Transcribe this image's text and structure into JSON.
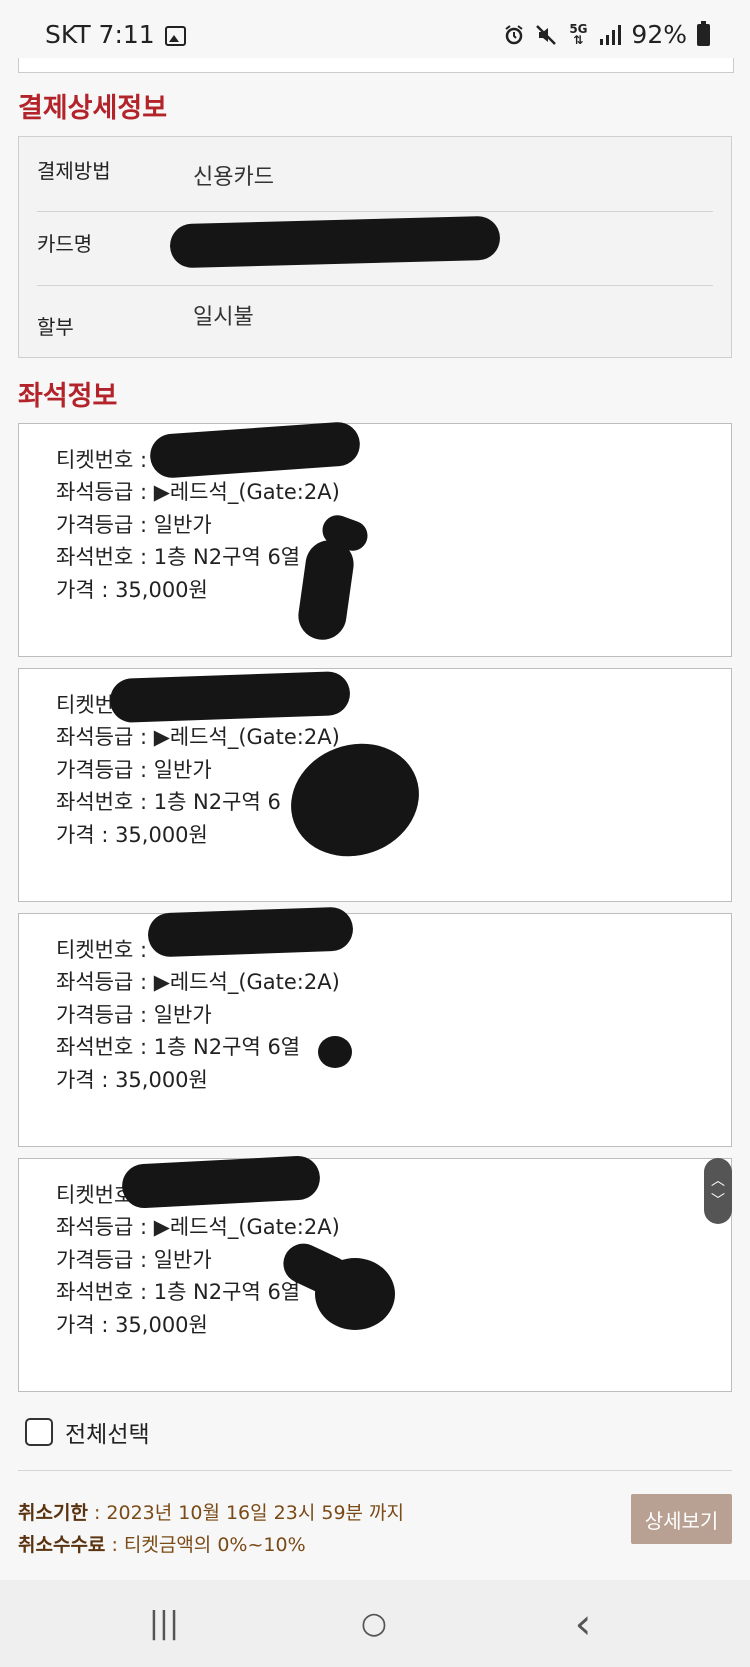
{
  "status_bar": {
    "carrier_time": "SKT 7:11",
    "network": "5G",
    "battery": "92%"
  },
  "payment_section": {
    "title": "결제상세정보",
    "rows": [
      {
        "label": "결제방법",
        "value": "신용카드"
      },
      {
        "label": "카드명",
        "value": ""
      },
      {
        "label": "할부",
        "value": "일시불"
      }
    ]
  },
  "seat_section": {
    "title": "좌석정보",
    "tickets": [
      {
        "ticket_no": "티켓번호 :",
        "grade": "좌석등급 : ▶레드석_(Gate:2A)",
        "price_grade": "가격등급 : 일반가",
        "seat_no": "좌석번호 : 1층 N2구역 6열",
        "price": "가격 : 35,000원"
      },
      {
        "ticket_no": "티켓번",
        "grade": "좌석등급 : ▶레드석_(Gate:2A)",
        "price_grade": "가격등급 : 일반가",
        "seat_no": "좌석번호 : 1층 N2구역 6",
        "price": "가격 : 35,000원"
      },
      {
        "ticket_no": "티켓번호 :",
        "grade": "좌석등급 : ▶레드석_(Gate:2A)",
        "price_grade": "가격등급 : 일반가",
        "seat_no": "좌석번호 : 1층 N2구역 6열",
        "price": "가격 : 35,000원"
      },
      {
        "ticket_no": "티켓번호",
        "grade": "좌석등급 : ▶레드석_(Gate:2A)",
        "price_grade": "가격등급 : 일반가",
        "seat_no": "좌석번호 : 1층 N2구역 6열",
        "price": "가격 : 35,000원"
      }
    ]
  },
  "select_all_label": "전체선택",
  "cancel_info": {
    "deadline_label": "취소기한",
    "deadline_value": " : 2023년 10월 16일 23시 59분 까지",
    "fee_label": "취소수수료",
    "fee_value": " : 티켓금액의 0%~10%"
  },
  "detail_button": "상세보기",
  "nav": {
    "recent": "|||",
    "home": "○",
    "back": "‹"
  },
  "colors": {
    "section_title": "#b3232a",
    "detail_button_bg": "#b8a192",
    "info_text": "#7a4a17"
  }
}
